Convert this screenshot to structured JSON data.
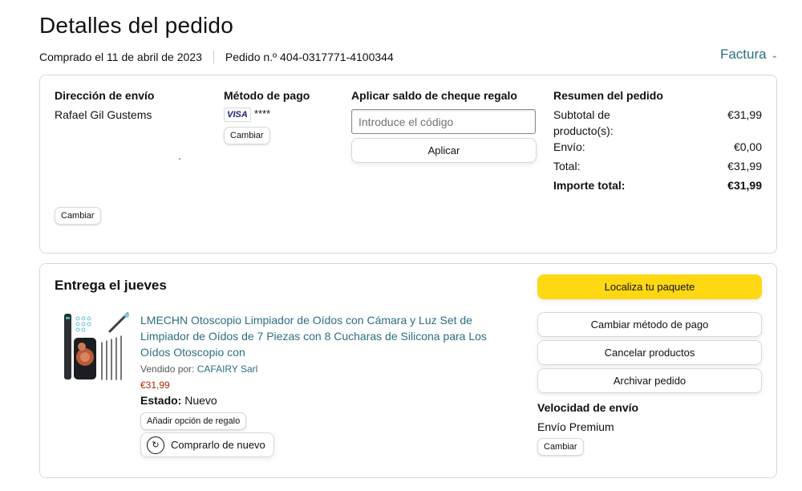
{
  "header": {
    "title": "Detalles del pedido",
    "purchase_date": "Comprado el 11 de abril de 2023",
    "order_number": "Pedido n.º 404-0317771-4100344",
    "invoice_label": "Factura"
  },
  "summary_card": {
    "shipping": {
      "heading": "Dirección de envío",
      "name": "Rafael Gil Gustems",
      "change_label": "Cambiar"
    },
    "payment": {
      "heading": "Método de pago",
      "card_brand": "VISA",
      "card_mask": "****",
      "change_label": "Cambiar"
    },
    "gift_card": {
      "heading": "Aplicar saldo de cheque regalo",
      "placeholder": "Introduce el código",
      "apply_label": "Aplicar"
    },
    "order_summary": {
      "heading": "Resumen del pedido",
      "rows": [
        {
          "label": "Subtotal de producto(s):",
          "value": "€31,99"
        },
        {
          "label": "Envío:",
          "value": "€0,00"
        },
        {
          "label": "Total:",
          "value": "€31,99"
        }
      ],
      "grand_total": {
        "label": "Importe total:",
        "value": "€31,99"
      }
    }
  },
  "delivery_card": {
    "title": "Entrega el jueves",
    "product": {
      "title": "LMECHN Otoscopio Limpiador de Oídos con Cámara y Luz Set de Limpiador de Oídos de 7 Piezas con 8 Cucharas de Silicona para Los Oídos Otoscopio con",
      "sold_by_label": "Vendido por:",
      "seller": "CAFAIRY Sarl",
      "price": "€31,99",
      "condition_label": "Estado:",
      "condition_value": "Nuevo",
      "gift_option_label": "Añadir opción de regalo",
      "buy_again_label": "Comprarlo de nuevo"
    },
    "actions": {
      "track": "Localiza tu paquete",
      "change_payment": "Cambiar método de pago",
      "cancel": "Cancelar productos",
      "archive": "Archivar pedido"
    },
    "shipping_speed": {
      "heading": "Velocidad de envío",
      "value": "Envío Premium",
      "change_label": "Cambiar"
    }
  },
  "colors": {
    "link": "#2a6f81",
    "price": "#b12704",
    "primary_button": "#ffd814",
    "border": "#d5d9d9"
  },
  "icons": [
    "chevron-down-icon",
    "visa-card-icon",
    "rebuy-icon",
    "product-thumbnail"
  ]
}
